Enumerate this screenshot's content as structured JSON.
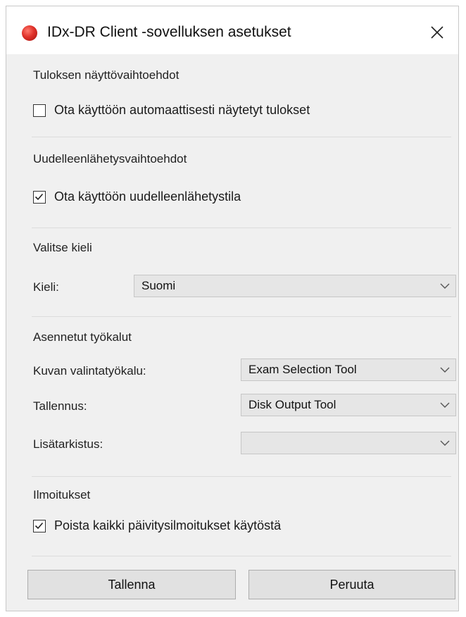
{
  "window": {
    "title": "IDx-DR Client -sovelluksen asetukset"
  },
  "results": {
    "heading": "Tuloksen näyttövaihtoehdot",
    "auto_show_label": "Ota käyttöön automaattisesti näytetyt tulokset",
    "auto_show_checked": false
  },
  "resend": {
    "heading": "Uudelleenlähetysvaihtoehdot",
    "resend_mode_label": "Ota käyttöön uudelleenlähetystila",
    "resend_mode_checked": true
  },
  "language": {
    "heading": "Valitse kieli",
    "label": "Kieli:",
    "selected": "Suomi"
  },
  "tools": {
    "heading": "Asennetut työkalut",
    "image_selection_label": "Kuvan valintatyökalu:",
    "image_selection_value": "Exam Selection Tool",
    "save_label": "Tallennus:",
    "save_value": "Disk Output Tool",
    "extra_check_label": "Lisätarkistus:",
    "extra_check_value": ""
  },
  "notifications": {
    "heading": "Ilmoitukset",
    "disable_updates_label": "Poista kaikki päivitysilmoitukset käytöstä",
    "disable_updates_checked": true
  },
  "buttons": {
    "save": "Tallenna",
    "cancel": "Peruuta"
  },
  "icons": {
    "app": "idx-dr-app-icon",
    "close": "close-icon",
    "check": "checkmark-icon",
    "dropdown": "chevron-down-icon"
  }
}
